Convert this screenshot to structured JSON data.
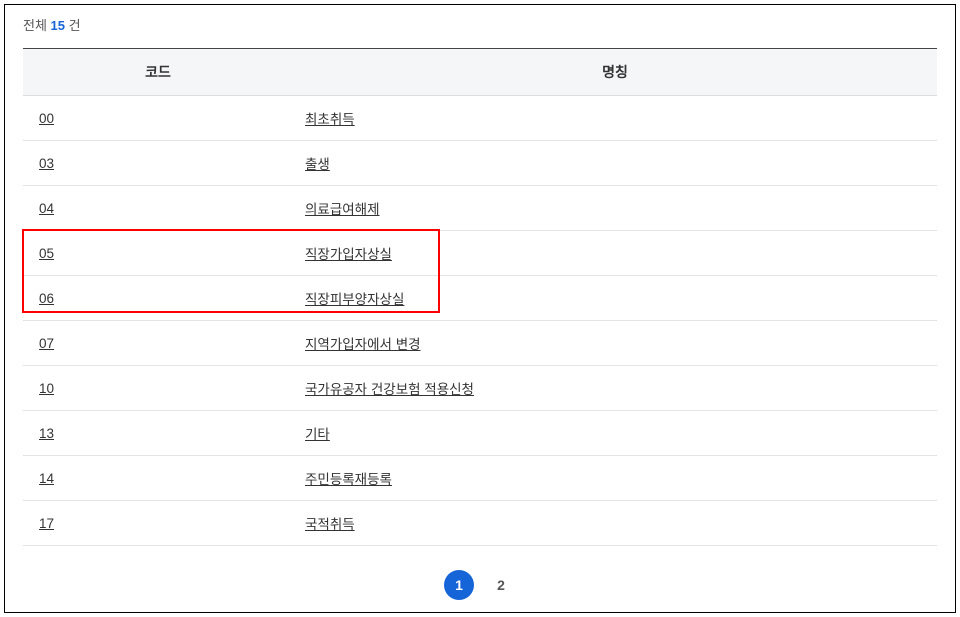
{
  "summary": {
    "prefix": "전체",
    "count": "15",
    "suffix": " 건"
  },
  "table": {
    "headers": {
      "code": "코드",
      "name": "명칭"
    },
    "rows": [
      {
        "code": "00",
        "name": "최초취득"
      },
      {
        "code": "03",
        "name": "출생"
      },
      {
        "code": "04",
        "name": "의료급여해제"
      },
      {
        "code": "05",
        "name": "직장가입자상실"
      },
      {
        "code": "06",
        "name": "직장피부양자상실"
      },
      {
        "code": "07",
        "name": "지역가입자에서 변경"
      },
      {
        "code": "10",
        "name": "국가유공자 건강보험 적용신청"
      },
      {
        "code": "13",
        "name": "기타"
      },
      {
        "code": "14",
        "name": "주민등록재등록"
      },
      {
        "code": "17",
        "name": "국적취득"
      }
    ]
  },
  "pagination": {
    "pages": [
      "1",
      "2"
    ],
    "current": "1"
  }
}
